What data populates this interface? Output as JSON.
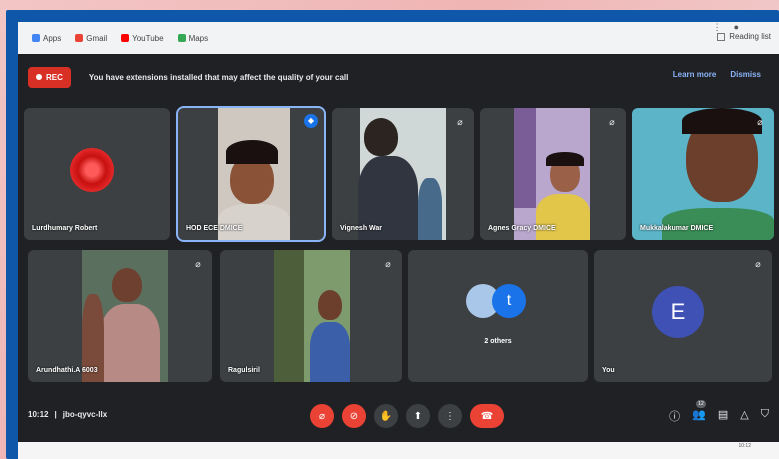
{
  "bookmarks": [
    {
      "label": "Apps",
      "color": "#4285f4"
    },
    {
      "label": "Gmail",
      "color": "#ea4335"
    },
    {
      "label": "YouTube",
      "color": "#ff0000"
    },
    {
      "label": "Maps",
      "color": "#34a853"
    }
  ],
  "reading_list": "Reading list",
  "notification": {
    "rec_label": "REC",
    "message": "You have extensions installed that may affect the quality of your call",
    "learn_more": "Learn more",
    "dismiss": "Dismiss"
  },
  "participants": [
    {
      "name": "Lurdhumary Robert",
      "muted": false
    },
    {
      "name": "HOD ECE DMICE",
      "speaking": true
    },
    {
      "name": "Vignesh War",
      "muted": true
    },
    {
      "name": "Agnes Gracy DMICE",
      "muted": true
    },
    {
      "name": "Mukkalakumar DMICE",
      "muted": true
    },
    {
      "name": "Arundhathi.A 6003",
      "muted": true
    },
    {
      "name": "Ragulsiril",
      "muted": true
    },
    {
      "name": "2 others",
      "initial": "t"
    },
    {
      "name": "You",
      "initial": "E"
    }
  ],
  "meeting": {
    "time": "10:12",
    "separator": "|",
    "code": "jbo-qyvc-llx"
  },
  "people_count": "12",
  "taskbar_time": "10:12",
  "colors": {
    "accent": "#8ab4f8",
    "end_call": "#ea4335",
    "avatar_t": "#1a73e8",
    "avatar_e": "#3f51b5"
  }
}
